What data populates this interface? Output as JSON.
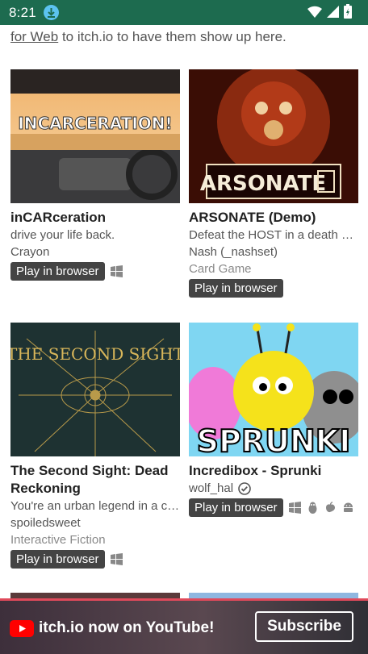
{
  "status": {
    "time": "8:21"
  },
  "intro": {
    "link": "for Web",
    "text": " to itch.io to have them show up here."
  },
  "games": [
    {
      "title": "inCARceration",
      "desc": "drive your life back.",
      "author": "Crayon",
      "genre": "",
      "play": "Play in browser",
      "platforms": [
        "windows-icon"
      ],
      "thumb_text": "INCARCERATION!"
    },
    {
      "title": "ARSONATE (Demo)",
      "desc": "Defeat the HOST in a death game...",
      "author": "Nash (_nashset)",
      "genre": "Card Game",
      "play": "Play in browser",
      "platforms": [],
      "thumb_text": "ARSONATE"
    },
    {
      "title": "The Second Sight: Dead Reckoning",
      "desc": "You're an urban legend in a city...",
      "author": "spoiledsweet",
      "genre": "Interactive Fiction",
      "play": "Play in browser",
      "platforms": [
        "windows-icon"
      ],
      "thumb_text": "THE SECOND SIGHT"
    },
    {
      "title": "Incredibox - Sprunki",
      "desc": "",
      "author": "wolf_hal",
      "genre": "",
      "play": "Play in browser",
      "platforms": [
        "windows-icon",
        "linux-icon",
        "apple-icon",
        "android-icon"
      ],
      "thumb_text": "SPRUNKI"
    }
  ],
  "banner": {
    "text": "itch.io now on YouTube!",
    "button": "Subscribe"
  },
  "colors": {
    "statusbar": "#1d6b4f",
    "button": "#444444",
    "banner_accent": "#e04a5b"
  }
}
